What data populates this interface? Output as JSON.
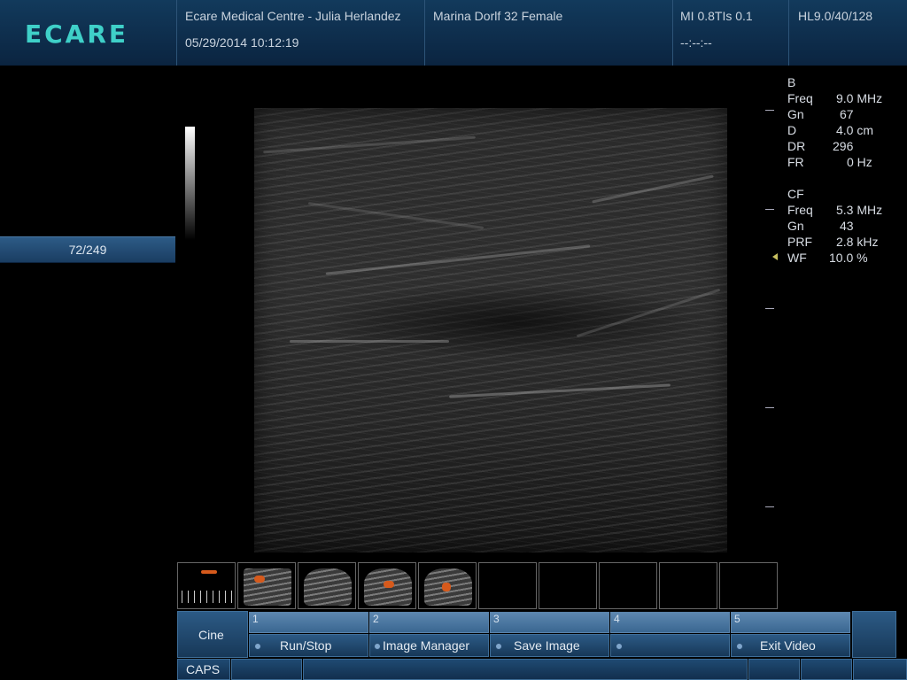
{
  "header": {
    "logo": "ECARE",
    "facility": "Ecare Medical Centre - Julia Herlandez",
    "datetime": "05/29/2014 10:12:19",
    "patient": "Marina Dorlf 32 Female",
    "mi_tis": "MI 0.8TIs 0.1",
    "timer": "--:--:--",
    "probe": "HL9.0/40/128"
  },
  "left_panel": {
    "frame_counter": "72/249"
  },
  "params": {
    "b_mode": {
      "title": "B",
      "rows": [
        {
          "label": "Freq",
          "value": "9.0 MHz"
        },
        {
          "label": "Gn",
          "value": "67"
        },
        {
          "label": "D",
          "value": "4.0 cm"
        },
        {
          "label": "DR",
          "value": "296"
        },
        {
          "label": "FR",
          "value": "0 Hz"
        }
      ]
    },
    "cf_mode": {
      "title": "CF",
      "rows": [
        {
          "label": "Freq",
          "value": "5.3 MHz"
        },
        {
          "label": "Gn",
          "value": "43"
        },
        {
          "label": "PRF",
          "value": "2.8 kHz"
        },
        {
          "label": "WF",
          "value": "10.0 %"
        }
      ]
    }
  },
  "thumbnails": {
    "filled": 5,
    "total": 10
  },
  "menu": {
    "cine_label": "Cine",
    "buttons": [
      {
        "number": "1",
        "label": "Run/Stop"
      },
      {
        "number": "2",
        "label": "Image Manager"
      },
      {
        "number": "3",
        "label": "Save Image"
      },
      {
        "number": "4",
        "label": ""
      },
      {
        "number": "5",
        "label": "Exit Video"
      }
    ]
  },
  "status_bar": {
    "caps": "CAPS"
  },
  "colors": {
    "accent": "#3fd0c8",
    "panel": "#123a5c",
    "flow": "#d65a1c"
  }
}
